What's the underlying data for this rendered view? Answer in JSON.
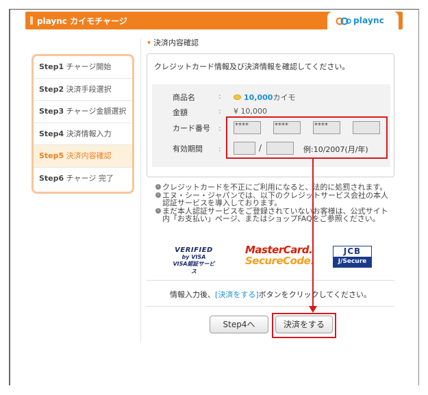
{
  "header": {
    "title": "plaync カイモチャージ",
    "logo_text": "plaync"
  },
  "steps": [
    {
      "num": "Step1",
      "label": "チャージ開始",
      "active": false
    },
    {
      "num": "Step2",
      "label": "決済手段選択",
      "active": false
    },
    {
      "num": "Step3",
      "label": "チャージ金額選択",
      "active": false
    },
    {
      "num": "Step4",
      "label": "決済情報入力",
      "active": false
    },
    {
      "num": "Step5",
      "label": "決済内容確認",
      "active": true
    },
    {
      "num": "Step6",
      "label": "チャージ 完了",
      "active": false
    }
  ],
  "section": {
    "title": "決済内容確認"
  },
  "confirm": {
    "message": "クレジットカード情報及び決済情報を確認してください。",
    "colon": ":",
    "product_label": "商品名",
    "product_amount": "10,000",
    "product_unit": "カイモ",
    "price_label": "金額",
    "price_value": "¥ 10,000",
    "card_label": "カード番号",
    "card_fields": [
      "****",
      "****",
      "****",
      ""
    ],
    "expiry_label": "有効期間",
    "expiry_month": "",
    "expiry_year": "",
    "expiry_slash": "/",
    "expiry_example": "例:10/2007(月/年)"
  },
  "notes": [
    "クレジットカードを不正にご利用になると、法的に処罰されます。",
    "エヌ・シー・ジャパンでは、以下のクレジットサービス会社の本人認証サービスを導入しております。",
    "まだ本人認証サービスをご登録されていないお客様は、公式サイト内「お支払い」ページ、またはショップFAQをご参照ください。"
  ],
  "logos": {
    "verified_line1": "VERIFIED",
    "verified_line2": "by VISA",
    "verified_line3": "VISA認証サービス",
    "mastercard_line1": "MasterCard.",
    "mastercard_line2": "SecureCode.",
    "jcb_line1": "JCB",
    "jcb_line2": "J/Secure"
  },
  "instruction": {
    "before": "情報入力後、",
    "link": "[決済をする]",
    "after": "ボタンをクリックしてください。"
  },
  "buttons": {
    "back": "Step4へ",
    "pay": "決済をする"
  },
  "colors": {
    "accent": "#f07f1e",
    "link": "#1a8fd4",
    "highlight": "#d7191c"
  }
}
